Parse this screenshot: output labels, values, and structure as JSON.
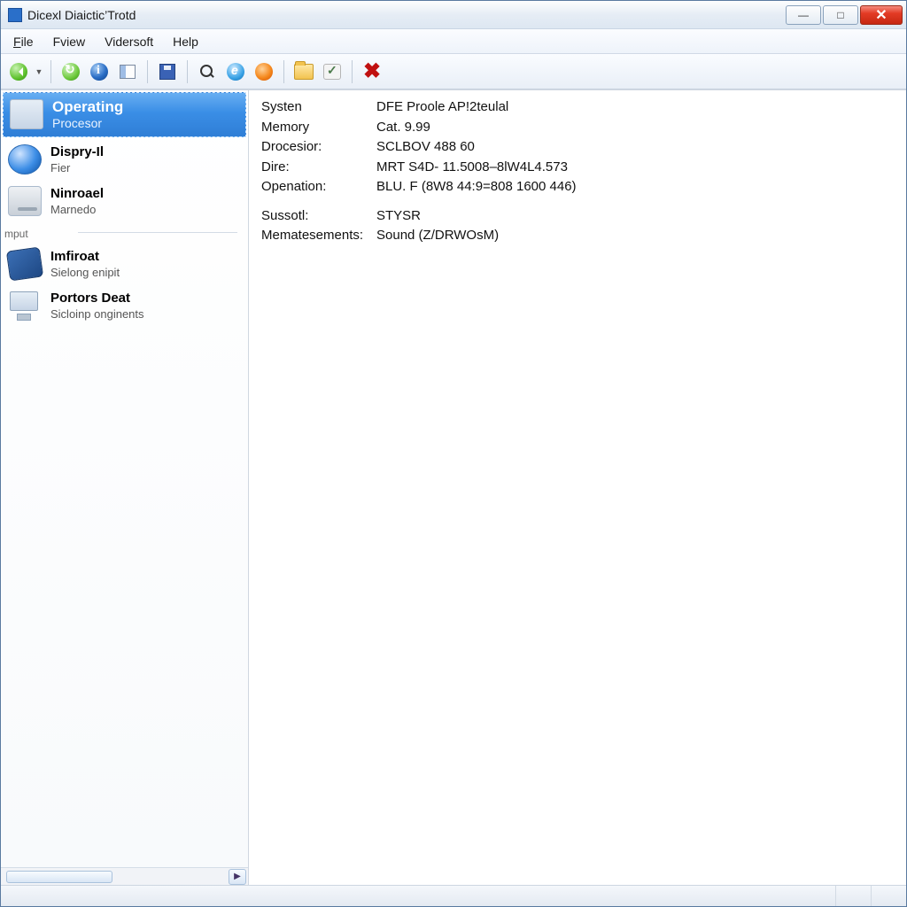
{
  "window": {
    "title": "Dicexl Diaictic’Trotd"
  },
  "menu": {
    "file": "File",
    "view": "Fview",
    "vidersoft": "Vidersoft",
    "help": "Help"
  },
  "sidebar": {
    "items": [
      {
        "name": "Operating",
        "sub": "Procesor"
      },
      {
        "name": "Dispry-Il",
        "sub": "Fier"
      },
      {
        "name": "Ninroael",
        "sub": "Marnedo"
      }
    ],
    "group_label": "mput",
    "group_items": [
      {
        "name": "Imfiroat",
        "sub": "Sielong enipit"
      },
      {
        "name": "Portors Deat",
        "sub": "Sicloinp onginents"
      }
    ]
  },
  "details": {
    "rows1": [
      {
        "k": "Systen",
        "v": "DFE Proole AP!2teulal"
      },
      {
        "k": "Memory",
        "v": "Cat. 9.99"
      },
      {
        "k": "Drocesior:",
        "v": "SCLBOV 488 60"
      },
      {
        "k": "Dire:",
        "v": "MRT S4D- 11.5008–8lW4L4.573"
      },
      {
        "k": "Openation:",
        "v": "BLU. F (8W8 44:9=808 1600 446)"
      }
    ],
    "rows2": [
      {
        "k": "Sussotl:",
        "v": "STYSR"
      },
      {
        "k": "Mematesements:",
        "v": "Sound (Z/DRWOsM)"
      }
    ]
  }
}
